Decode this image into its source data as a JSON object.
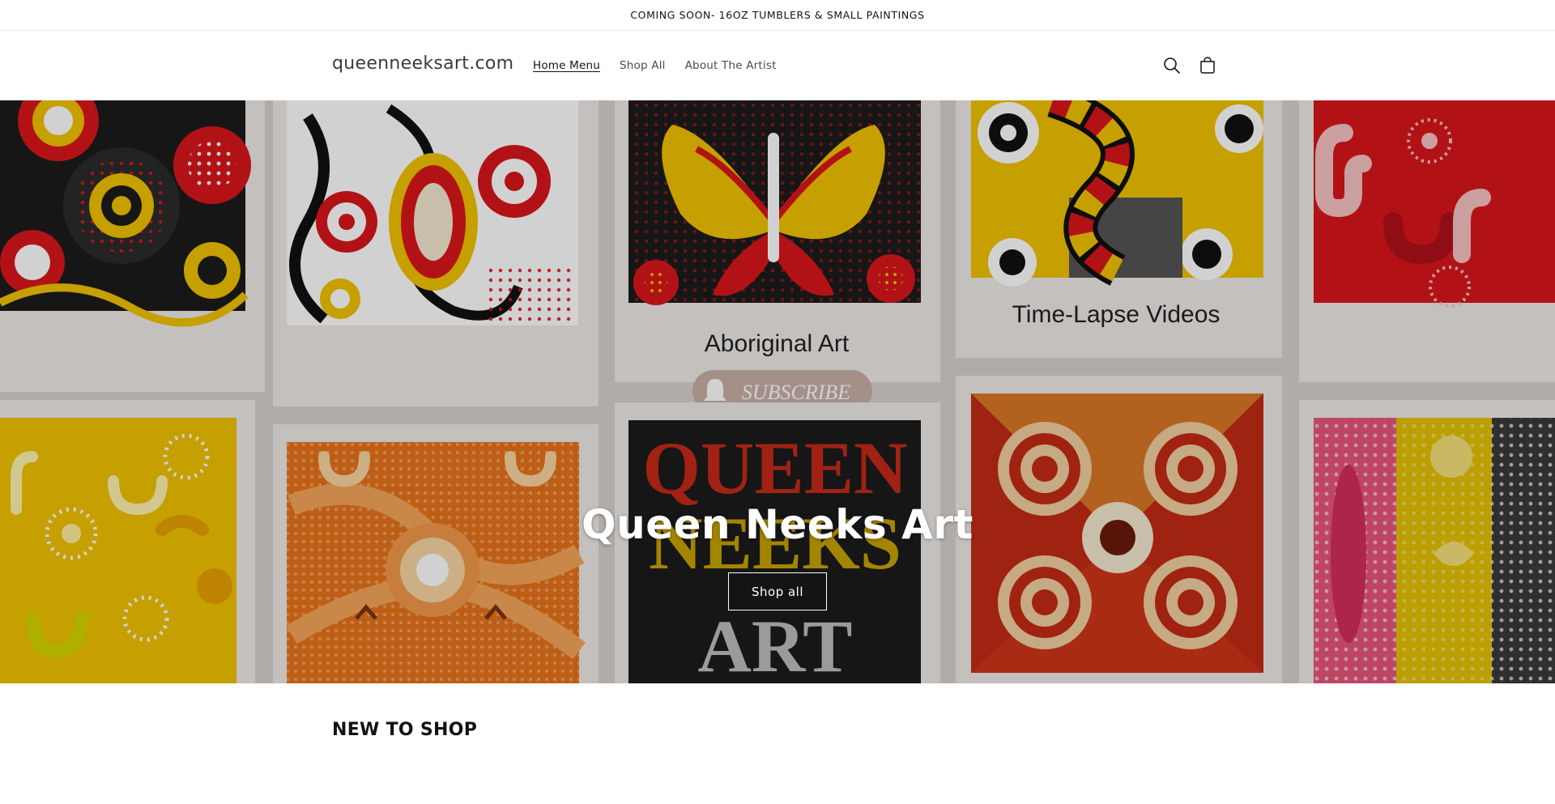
{
  "announcement": {
    "text": "COMING SOON- 16OZ TUMBLERS & SMALL PAINTINGS"
  },
  "header": {
    "logo": "queenneeksart.com",
    "nav": [
      {
        "label": "Home Menu",
        "active": true
      },
      {
        "label": "Shop All",
        "active": false
      },
      {
        "label": "About The Artist",
        "active": false
      }
    ],
    "icons": [
      "search-icon",
      "cart-icon"
    ]
  },
  "hero": {
    "title": "Queen Neeks Art",
    "button_label": "Shop all",
    "image_captions": {
      "aboriginal_art": "Aboriginal Art",
      "time_lapse": "Time-Lapse Videos",
      "subscribe": "SUBSCRIBE",
      "logo_line1": "QUEEN",
      "logo_line2": "NEEKS",
      "logo_line3": "ART"
    }
  },
  "new_section": {
    "title": "NEW TO SHOP"
  },
  "colors": {
    "accent_red": "#d9161c",
    "accent_yellow": "#f2c200",
    "accent_orange": "#e8731a",
    "dark": "#1d1d1d"
  }
}
